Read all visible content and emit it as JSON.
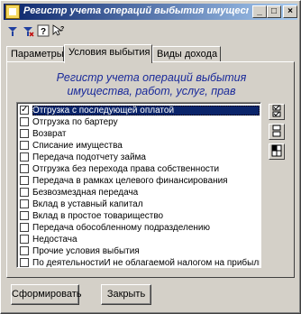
{
  "window": {
    "title": "Регистр учета операций выбытия имущества, ра",
    "controls": {
      "minimize": "_",
      "maximize": "□",
      "close": "×"
    }
  },
  "toolbar": {
    "icons": [
      "filter-add-icon",
      "filter-remove-icon",
      "help-icon",
      "context-help-icon"
    ]
  },
  "tabs": [
    {
      "label": "Параметры",
      "active": false
    },
    {
      "label": "Условия выбытия",
      "active": true
    },
    {
      "label": "Виды дохода",
      "active": false
    }
  ],
  "panel": {
    "heading_line1": "Регистр учета операций выбытия",
    "heading_line2": "имущества, работ, услуг, прав"
  },
  "list": {
    "items": [
      {
        "label": "Отгрузка с последующей оплатой",
        "checked": true,
        "selected": true
      },
      {
        "label": "Отгрузка по бартеру",
        "checked": false
      },
      {
        "label": "Возврат",
        "checked": false
      },
      {
        "label": "Списание имущества",
        "checked": false
      },
      {
        "label": "Передача подотчету займа",
        "checked": false
      },
      {
        "label": "Отгрузка без перехода права собственности",
        "checked": false
      },
      {
        "label": "Передача в рамках целевого финансирования",
        "checked": false
      },
      {
        "label": "Безвозмездная передача",
        "checked": false
      },
      {
        "label": "Вклад в уставный капитал",
        "checked": false
      },
      {
        "label": "Вклад в простое товарищество",
        "checked": false
      },
      {
        "label": "Передача обособленному подразделению",
        "checked": false
      },
      {
        "label": "Недостача",
        "checked": false
      },
      {
        "label": "Прочие условия выбытия",
        "checked": false
      },
      {
        "label": "По деятельностиИ не облагаемой налогом на прибыль",
        "checked": false
      }
    ]
  },
  "side_buttons": [
    "select-all-icon",
    "deselect-all-icon",
    "invert-selection-icon"
  ],
  "buttons": {
    "form": "Сформировать",
    "close": "Закрыть"
  }
}
